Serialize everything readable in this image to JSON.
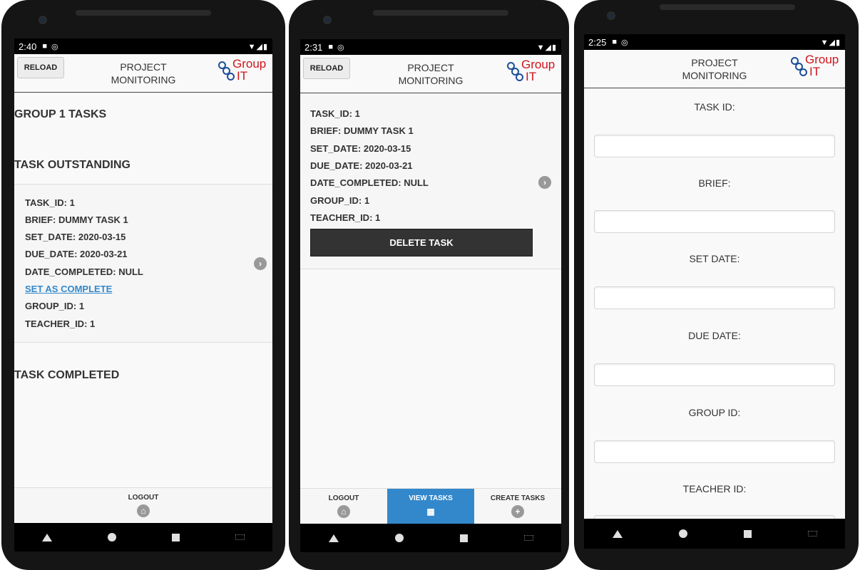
{
  "header": {
    "reload_label": "RELOAD",
    "title_line1": "PROJECT",
    "title_line2": "MONITORING",
    "logo_word1": "Group",
    "logo_word2": "IT"
  },
  "screen1": {
    "status_time": "2:40",
    "heading_group": "GROUP 1 TASKS",
    "heading_outstanding": "TASK OUTSTANDING",
    "heading_completed": "TASK COMPLETED",
    "task": {
      "task_id": "TASK_ID: 1",
      "brief": "BRIEF: DUMMY TASK 1",
      "set_date": "SET_DATE: 2020-03-15",
      "due_date": "DUE_DATE: 2020-03-21",
      "date_completed": "DATE_COMPLETED: NULL",
      "set_complete_link": "SET AS COMPLETE",
      "group_id": "GROUP_ID: 1",
      "teacher_id": "TEACHER_ID: 1"
    },
    "footer": {
      "logout": "LOGOUT"
    }
  },
  "screen2": {
    "status_time": "2:31",
    "task": {
      "task_id": "TASK_ID: 1",
      "brief": "BRIEF: DUMMY TASK 1",
      "set_date": "SET_DATE: 2020-03-15",
      "due_date": "DUE_DATE: 2020-03-21",
      "date_completed": "DATE_COMPLETED: NULL",
      "group_id": "GROUP_ID: 1",
      "teacher_id": "TEACHER_ID: 1"
    },
    "delete_label": "DELETE TASK",
    "footer": {
      "logout": "LOGOUT",
      "view_tasks": "VIEW TASKS",
      "create_tasks": "CREATE TASKS"
    }
  },
  "screen3": {
    "status_time": "2:25",
    "labels": {
      "task_id": "TASK ID:",
      "brief": "BRIEF:",
      "set_date": "SET DATE:",
      "due_date": "DUE DATE:",
      "group_id": "GROUP ID:",
      "teacher_id": "TEACHER ID:"
    }
  },
  "colors": {
    "accent": "#3388cc",
    "logo_red": "#d0141b",
    "logo_blue": "#1d4f9a",
    "button_dark": "#333333"
  },
  "icons": {
    "arrow": "chevron-right-icon",
    "home": "home-icon",
    "grid": "grid-icon",
    "plus": "plus-icon"
  }
}
